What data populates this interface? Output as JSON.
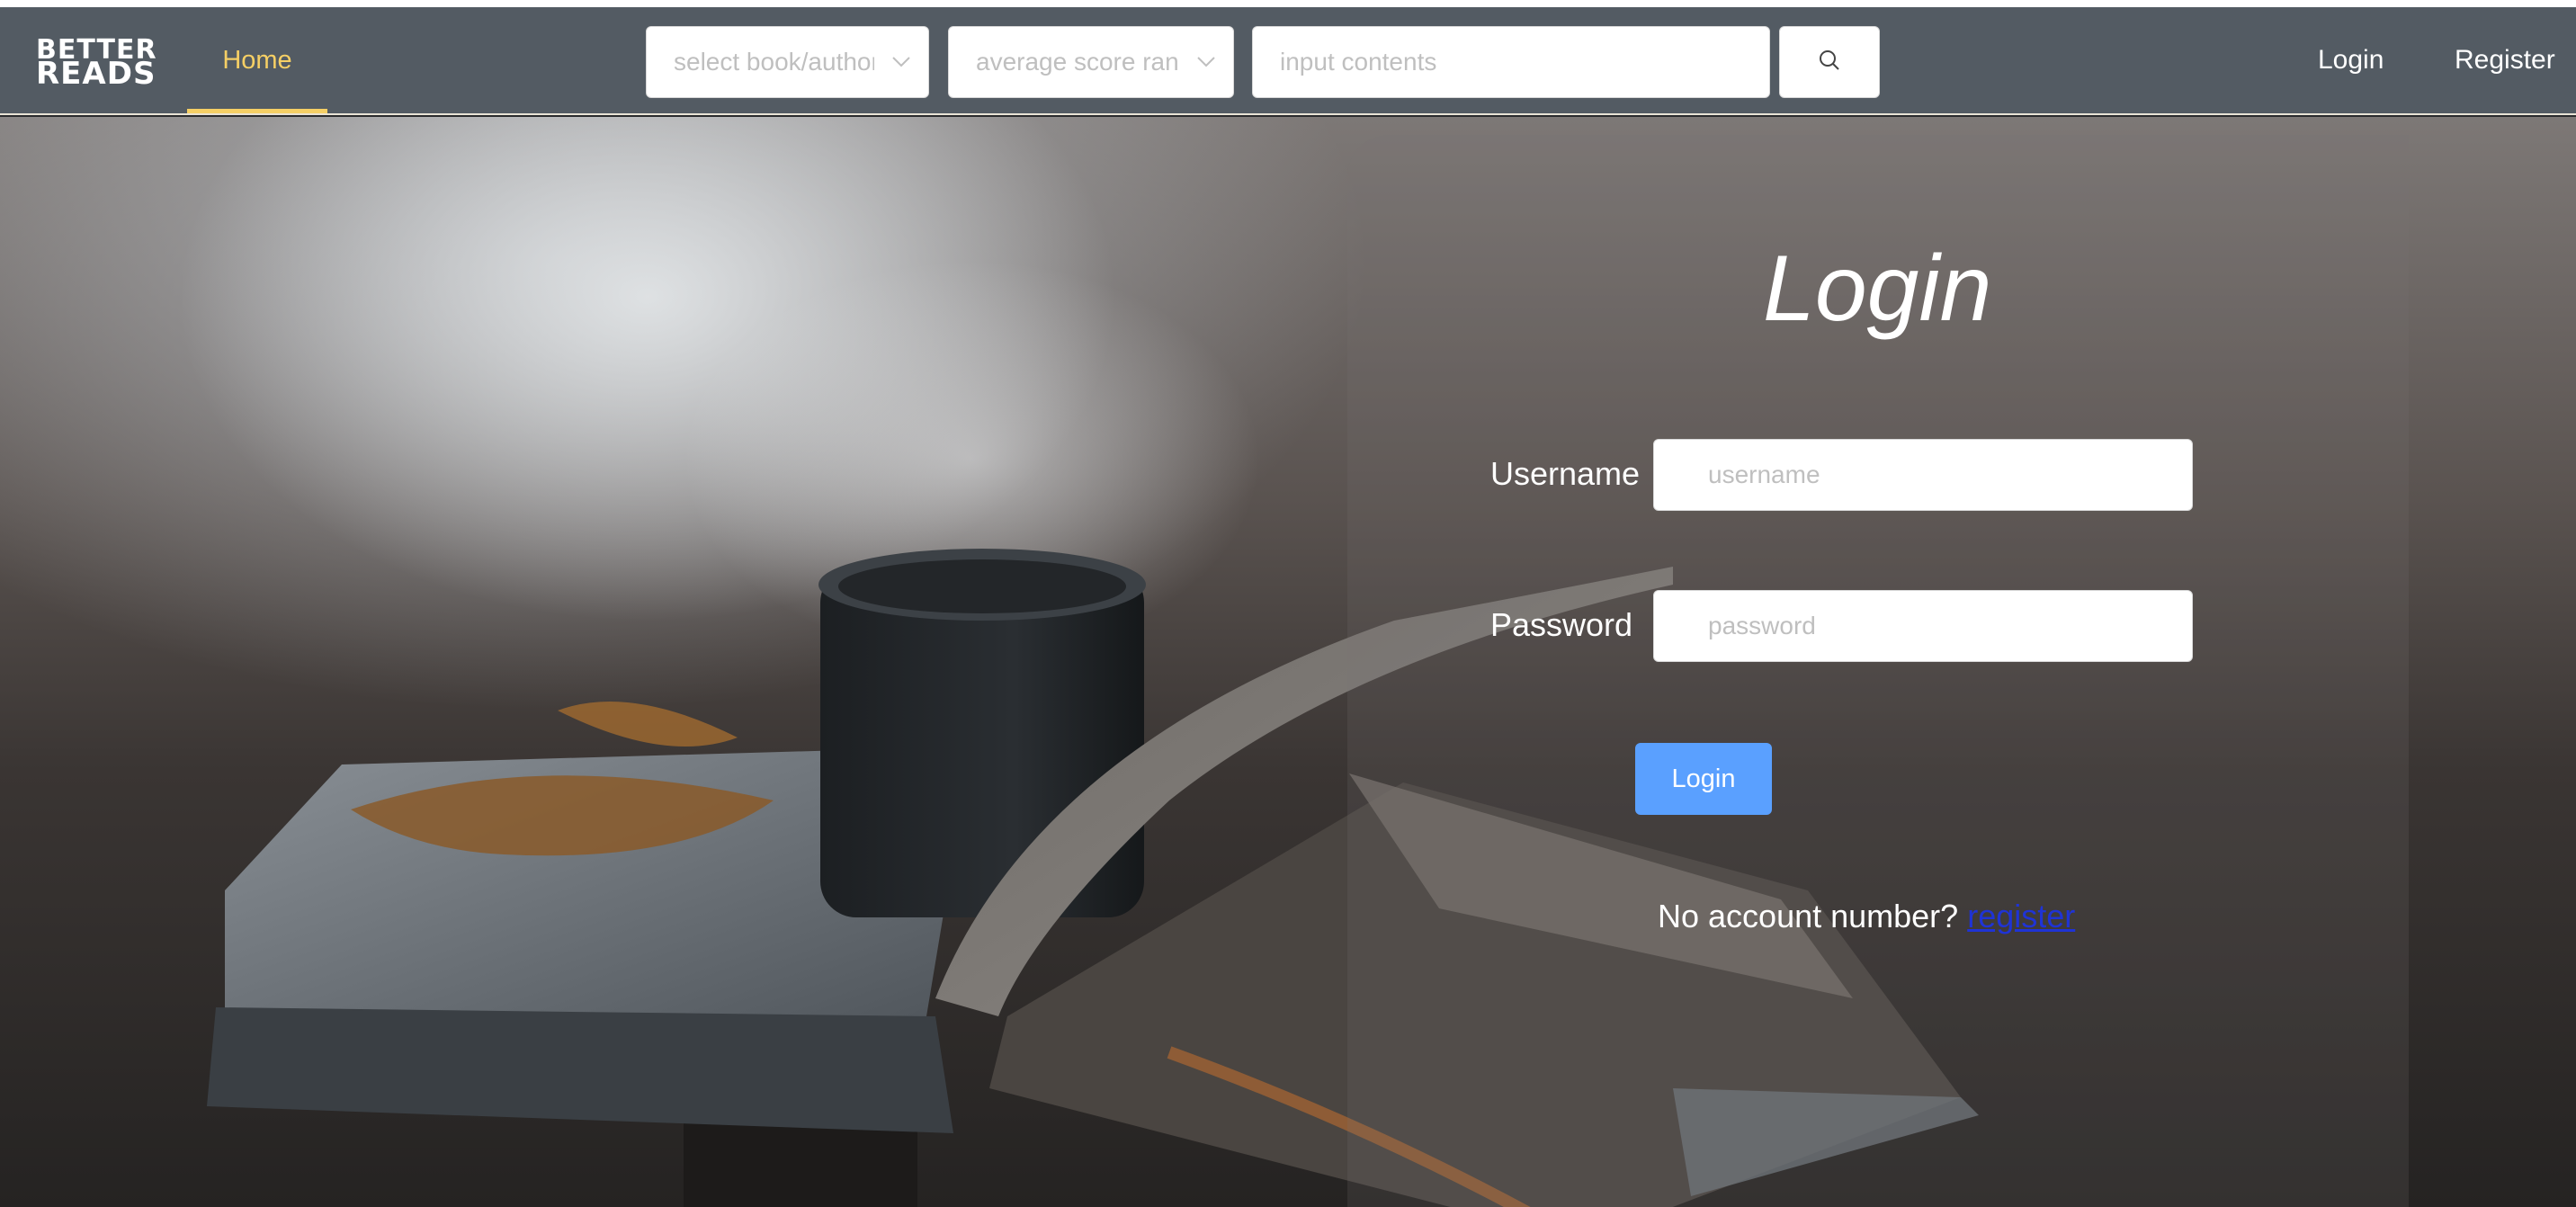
{
  "navbar": {
    "logo_line1": "BETTER",
    "logo_line2": "READS",
    "home_label": "Home",
    "select_type_placeholder": "select book/author",
    "select_score_placeholder": "average score range",
    "search_placeholder": "input contents",
    "login_label": "Login",
    "register_label": "Register"
  },
  "login_form": {
    "title": "Login",
    "username_label": "Username",
    "username_placeholder": "username",
    "password_label": "Password",
    "password_placeholder": "password",
    "submit_label": "Login",
    "no_account_text": "No account number?",
    "register_link": "register"
  },
  "colors": {
    "navbar_bg": "#535b63",
    "active_nav": "#f5cf65",
    "primary_button": "#5aa0ff",
    "link": "#1f33d6"
  },
  "icons": {
    "search": "search-icon",
    "select_arrow": "chevron-down-icon"
  }
}
